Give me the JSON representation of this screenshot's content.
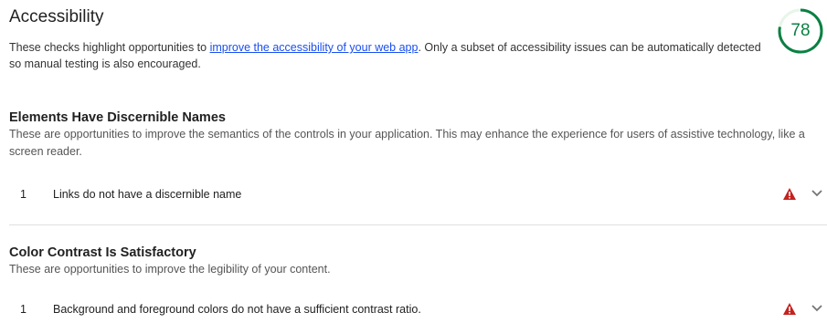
{
  "header": {
    "title": "Accessibility",
    "desc_before": "These checks highlight opportunities to ",
    "link_text": "improve the accessibility of your web app",
    "desc_after": ". Only a subset of accessibility issues can be automatically detected so manual testing is also encouraged."
  },
  "score": {
    "value": "78",
    "fraction": 0.78,
    "color": "#0b8043"
  },
  "sections": [
    {
      "title": "Elements Have Discernible Names",
      "description": "These are opportunities to improve the semantics of the controls in your application. This may enhance the experience for users of assistive technology, like a screen reader.",
      "audits": [
        {
          "index": "1",
          "label": "Links do not have a discernible name",
          "icon": "warning-triangle-icon"
        }
      ]
    },
    {
      "title": "Color Contrast Is Satisfactory",
      "description": "These are opportunities to improve the legibility of your content.",
      "audits": [
        {
          "index": "1",
          "label": "Background and foreground colors do not have a sufficient contrast ratio.",
          "icon": "warning-triangle-icon"
        }
      ]
    }
  ],
  "colors": {
    "warning": "#c5221f",
    "link": "#1a4ff0",
    "score_ring": "#0b8043"
  }
}
